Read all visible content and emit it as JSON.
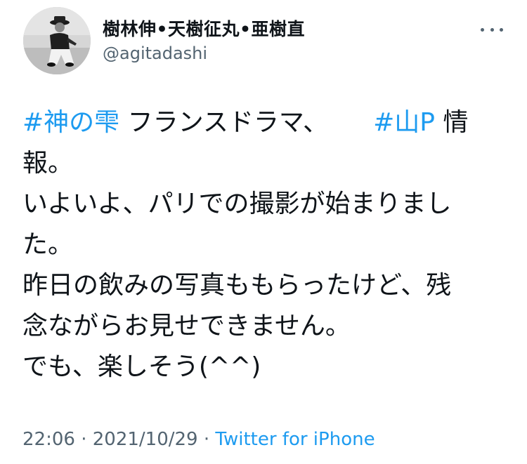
{
  "author": {
    "name": "樹林伸•天樹征丸•亜樹直",
    "handle": "@agitadashi"
  },
  "icons": {
    "avatar": "avatar-photo",
    "more": "more-options-icon"
  },
  "tweet": {
    "line1": {
      "hashtag1": "#神の雫",
      "text1": "フランスドラマ、",
      "hashtag2": "#山P",
      "text2": "情"
    },
    "line2": "報。",
    "line3": "いよいよ、パリでの撮影が始まりまし",
    "line4": "た。",
    "line5": "昨日の飲みの写真ももらったけど、残",
    "line6": "念ながらお見せできません。",
    "line7": "でも、楽しそう(^^)"
  },
  "meta": {
    "time": "22:06",
    "sep1": "·",
    "date": "2021/10/29",
    "sep2": "·",
    "source": "Twitter for iPhone"
  },
  "colors": {
    "link": "#1d9bf0",
    "text": "#0f1419",
    "secondary": "#536471"
  }
}
